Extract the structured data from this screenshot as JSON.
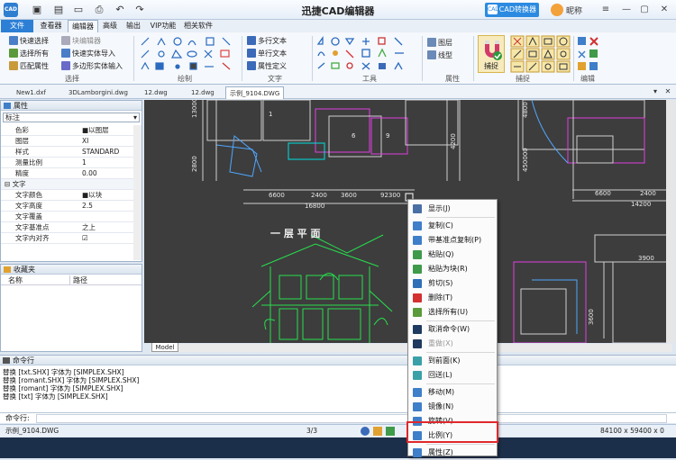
{
  "app": {
    "title": "迅捷CAD编辑器",
    "logo_text": "CAD",
    "convert_button": "CAD转换器",
    "nickname": "昵称"
  },
  "quick_access_icons": [
    "save-icon",
    "save-as-icon",
    "open-icon",
    "print-icon",
    "undo-icon",
    "redo-icon"
  ],
  "ribbon_tabs": [
    {
      "label": "文件",
      "name": "tab-file"
    },
    {
      "label": "查看器",
      "name": "tab-viewer"
    },
    {
      "label": "编辑器",
      "name": "tab-editor"
    },
    {
      "label": "高级",
      "name": "tab-advanced"
    },
    {
      "label": "输出",
      "name": "tab-output"
    },
    {
      "label": "VIP功能",
      "name": "tab-vip"
    },
    {
      "label": "相关软件",
      "name": "tab-related"
    }
  ],
  "ribbon": {
    "select": {
      "label": "选择",
      "quick_select": "快速选择",
      "select_all": "选择所有",
      "match_props": "匹配属性",
      "block_editor": "块编辑器",
      "quick_solid_import": "快速实体导入",
      "polygon_solid_input": "多边形实体输入"
    },
    "draw": {
      "label": "绘制"
    },
    "text": {
      "label": "文字",
      "mtext": "多行文本",
      "stext": "单行文本",
      "attdef": "属性定义"
    },
    "tools": {
      "label": "工具"
    },
    "props": {
      "label": "属性",
      "layer": "图层",
      "linetype": "线型"
    },
    "snap": {
      "label": "捕捉",
      "capture": "捕捉"
    },
    "edit": {
      "label": "编辑"
    }
  },
  "doc_tabs": [
    "New1.dxf",
    "3DLamborgini.dwg",
    "12.dwg",
    "12.dwg",
    "示例_9104.DWG"
  ],
  "properties_panel": {
    "title": "属性",
    "dropdown": "标注",
    "rows": [
      {
        "k": "色彩",
        "v": "■以图层"
      },
      {
        "k": "图层",
        "v": "XI"
      },
      {
        "k": "样式",
        "v": "STANDARD"
      },
      {
        "k": "测量比例",
        "v": "1"
      },
      {
        "k": "精度",
        "v": "0.00"
      }
    ],
    "section": "文字",
    "text_rows": [
      {
        "k": "文字颜色",
        "v": "■以块"
      },
      {
        "k": "文字高度",
        "v": "2.5"
      },
      {
        "k": "文字覆盖",
        "v": ""
      },
      {
        "k": "文字基准点",
        "v": "之上"
      },
      {
        "k": "文字内对齐",
        "v": "☑"
      }
    ]
  },
  "favorites_panel": {
    "title": "收藏夹",
    "col_name": "名称",
    "col_path": "路径"
  },
  "drawing": {
    "caption": "一 层 平 面",
    "dims": [
      "6600",
      "2400",
      "3600",
      "92300",
      "16800",
      "6600",
      "2400",
      "14200",
      "3900",
      "4200",
      "13000",
      "2800",
      "4800",
      "450000",
      "3600"
    ],
    "room_numbers": [
      "1",
      "6",
      "9"
    ]
  },
  "model_tab": "Model",
  "command": {
    "title": "命令行",
    "lines": [
      "替换 [txt.SHX] 字体为 [SIMPLEX.SHX]",
      "替换 [romant.SHX] 字体为 [SIMPLEX.SHX]",
      "替换 [romant] 字体为 [SIMPLEX.SHX]",
      "替换 [txt] 字体为 [SIMPLEX.SHX]"
    ],
    "prompt": "命令行:"
  },
  "status": {
    "file": "示例_9104.DWG",
    "page": "3/3",
    "coords": "84100 x 59400 x 0"
  },
  "context_menu": [
    {
      "label": "显示(J)",
      "icon": "display-icon",
      "color": "#4a6fa5"
    },
    {
      "sep": true
    },
    {
      "label": "复制(C)",
      "icon": "copy-icon",
      "color": "#3f7ec9"
    },
    {
      "label": "带基准点复制(P)",
      "icon": "copy-base-icon",
      "color": "#3f7ec9"
    },
    {
      "label": "粘贴(Q)",
      "icon": "paste-icon",
      "color": "#3f9a4a"
    },
    {
      "label": "粘贴为块(R)",
      "icon": "paste-block-icon",
      "color": "#3f9a4a"
    },
    {
      "label": "剪切(S)",
      "icon": "cut-icon",
      "color": "#2e6fb8"
    },
    {
      "label": "删除(T)",
      "icon": "delete-icon",
      "color": "#d43030"
    },
    {
      "label": "选择所有(U)",
      "icon": "select-all-icon",
      "color": "#5a9a3a"
    },
    {
      "sep": true
    },
    {
      "label": "取消命令(W)",
      "icon": "cancel-cmd-icon",
      "color": "#1e3a60"
    },
    {
      "label": "重做(X)",
      "icon": "redo-menu-icon",
      "color": "#1e3a60",
      "disabled": true
    },
    {
      "sep": true
    },
    {
      "label": "到前面(K)",
      "icon": "bring-front-icon",
      "color": "#3aa0a8"
    },
    {
      "label": "回送(L)",
      "icon": "send-back-icon",
      "color": "#3aa0a8"
    },
    {
      "sep": true
    },
    {
      "label": "移动(M)",
      "icon": "move-icon",
      "color": "#3f7ec9"
    },
    {
      "label": "镜像(N)",
      "icon": "mirror-icon",
      "color": "#3f7ec9"
    },
    {
      "label": "旋转(V)",
      "icon": "rotate-icon",
      "color": "#3f7ec9"
    },
    {
      "label": "比例(Y)",
      "icon": "scale-icon",
      "color": "#3f7ec9"
    },
    {
      "sep": true
    },
    {
      "label": "属性(Z)",
      "icon": "properties-icon",
      "color": "#3f7ec9"
    }
  ],
  "colors": {
    "accent": "#2c7fd5",
    "highlight": "#e0282c",
    "canvas": "#3d3d3d",
    "house": "#27e04d"
  }
}
